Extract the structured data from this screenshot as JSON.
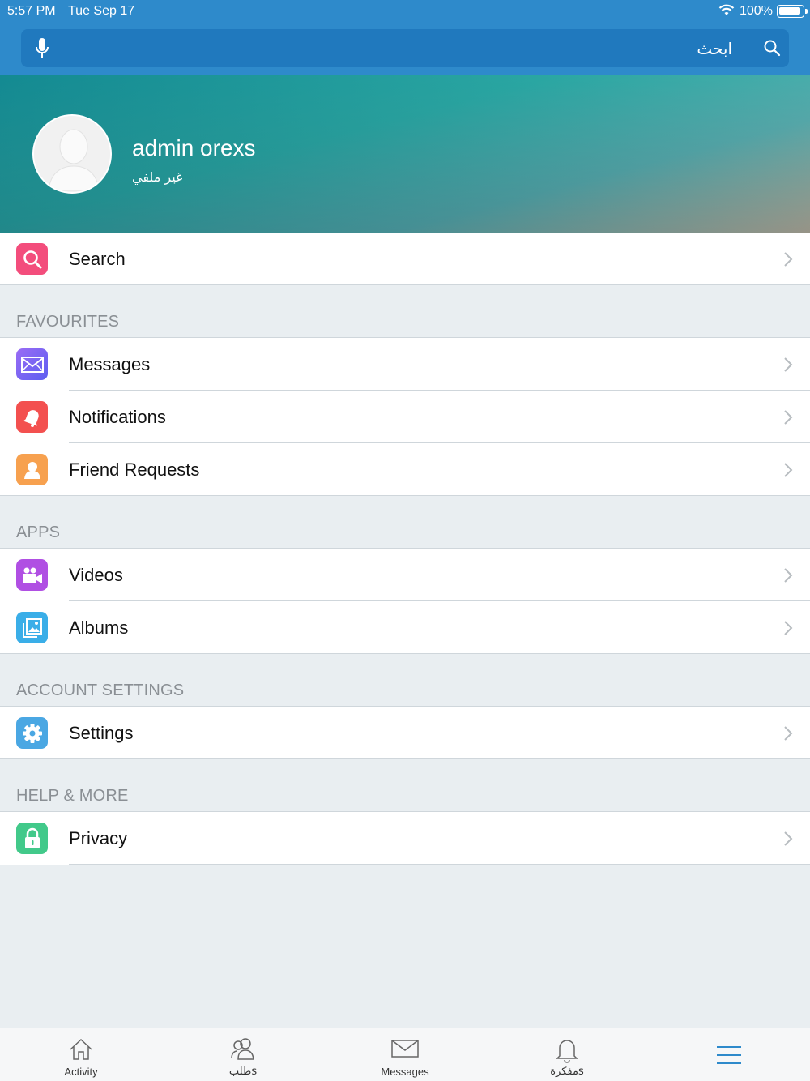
{
  "status_bar": {
    "time": "5:57 PM",
    "date": "Tue Sep 17",
    "battery": "100%"
  },
  "search": {
    "placeholder": "ابحث"
  },
  "profile": {
    "name": "admin orexs",
    "subtitle": "غير ملفي"
  },
  "rows": {
    "search": "Search",
    "messages": "Messages",
    "notifications": "Notifications",
    "friend_requests": "Friend Requests",
    "videos": "Videos",
    "albums": "Albums",
    "settings": "Settings",
    "privacy": "Privacy"
  },
  "sections": {
    "favourites": "FAVOURITES",
    "apps": "APPS",
    "account_settings": "ACCOUNT SETTINGS",
    "help": "HELP & MORE"
  },
  "tabs": {
    "activity": "Activity",
    "requests": "طلبs",
    "messages": "Messages",
    "notifications": "مفكرةs",
    "menu": ""
  },
  "colors": {
    "header": "#2e8acb",
    "search_icon": "#f34d7c",
    "messages_icon": "#7b61f0",
    "notifications_icon": "#f3504f",
    "friends_icon": "#f7a14f",
    "videos_icon": "#b04fe3",
    "albums_icon": "#3aaee8",
    "settings_icon": "#4aa7e3",
    "privacy_icon": "#42c98a",
    "menu_active": "#2e8acb"
  },
  "icons": {
    "search": "magnifier-icon",
    "messages": "envelope-icon",
    "notifications": "bell-icon",
    "friend_requests": "person-icon",
    "videos": "video-camera-icon",
    "albums": "photo-icon",
    "settings": "gear-icon",
    "privacy": "lock-icon"
  }
}
